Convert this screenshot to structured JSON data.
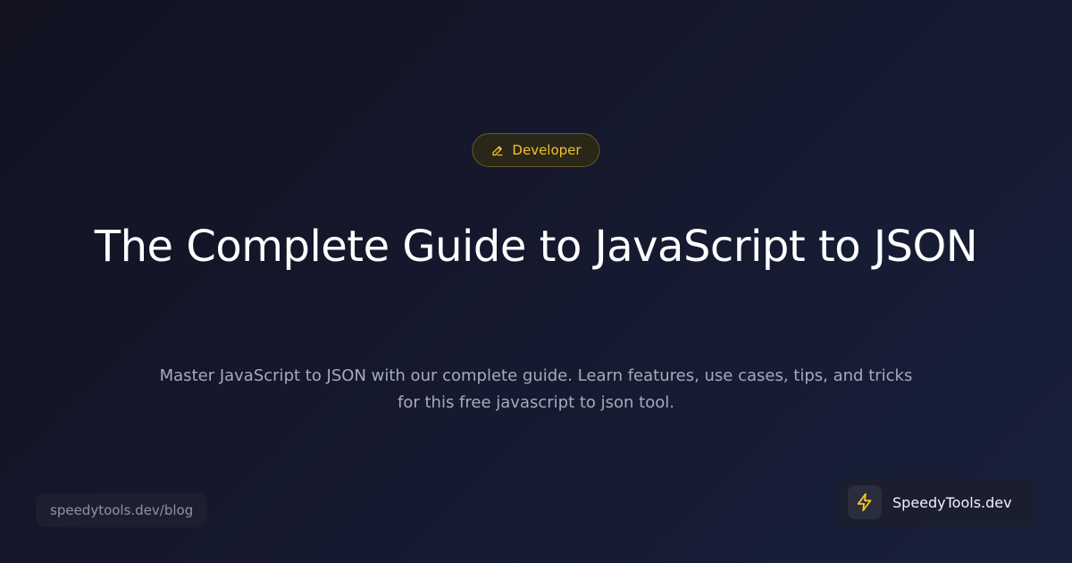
{
  "badge": {
    "label": "Developer",
    "icon": "pencil-icon",
    "color": "#f2c12e"
  },
  "article": {
    "title": "The Complete Guide to JavaScript to JSON",
    "description": "Master JavaScript to JSON with our complete guide. Learn features, use cases, tips, and tricks for this free javascript to json tool."
  },
  "footer": {
    "url": "speedytools.dev/blog",
    "brand_name": "SpeedyTools.dev",
    "brand_icon": "lightning-bolt-icon"
  },
  "colors": {
    "accent": "#f2c12e",
    "background_start": "#121220",
    "background_end": "#18203c"
  }
}
